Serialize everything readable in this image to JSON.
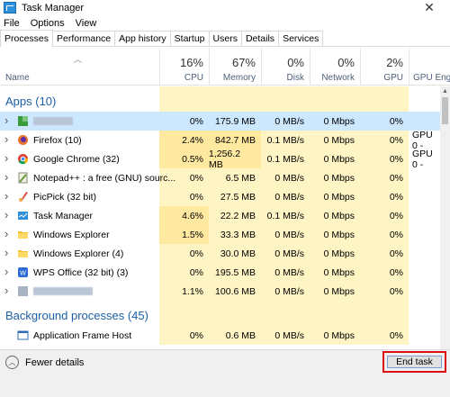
{
  "window": {
    "title": "Task Manager"
  },
  "menu": [
    "File",
    "Options",
    "View"
  ],
  "tabs": [
    "Processes",
    "Performance",
    "App history",
    "Startup",
    "Users",
    "Details",
    "Services"
  ],
  "columns": {
    "name_label": "Name",
    "cpu": {
      "pct": "16%",
      "label": "CPU"
    },
    "memory": {
      "pct": "67%",
      "label": "Memory"
    },
    "disk": {
      "pct": "0%",
      "label": "Disk"
    },
    "network": {
      "pct": "0%",
      "label": "Network"
    },
    "gpu": {
      "pct": "2%",
      "label": "GPU"
    },
    "gpu_engine": {
      "label": "GPU Engin"
    }
  },
  "groups": {
    "apps": "Apps (10)",
    "background": "Background processes (45)"
  },
  "apps": [
    {
      "name": "",
      "icon": "green-app-icon",
      "cpu": "0%",
      "memory": "175.9 MB",
      "disk": "0 MB/s",
      "network": "0 Mbps",
      "gpu": "0%",
      "gpu_engine": ""
    },
    {
      "name": "Firefox (10)",
      "icon": "firefox-icon",
      "cpu": "2.4%",
      "memory": "842.7 MB",
      "disk": "0.1 MB/s",
      "network": "0 Mbps",
      "gpu": "0%",
      "gpu_engine": "GPU 0 -"
    },
    {
      "name": "Google Chrome (32)",
      "icon": "chrome-icon",
      "cpu": "0.5%",
      "memory": "1,256.2 MB",
      "disk": "0.1 MB/s",
      "network": "0 Mbps",
      "gpu": "0%",
      "gpu_engine": "GPU 0 -"
    },
    {
      "name": "Notepad++ : a free (GNU) sourc...",
      "icon": "notepad-icon",
      "cpu": "0%",
      "memory": "6.5 MB",
      "disk": "0 MB/s",
      "network": "0 Mbps",
      "gpu": "0%",
      "gpu_engine": ""
    },
    {
      "name": "PicPick (32 bit)",
      "icon": "picpick-icon",
      "cpu": "0%",
      "memory": "27.5 MB",
      "disk": "0 MB/s",
      "network": "0 Mbps",
      "gpu": "0%",
      "gpu_engine": ""
    },
    {
      "name": "Task Manager",
      "icon": "task-manager-icon",
      "cpu": "4.6%",
      "memory": "22.2 MB",
      "disk": "0.1 MB/s",
      "network": "0 Mbps",
      "gpu": "0%",
      "gpu_engine": ""
    },
    {
      "name": "Windows Explorer",
      "icon": "folder-icon",
      "cpu": "1.5%",
      "memory": "33.3 MB",
      "disk": "0 MB/s",
      "network": "0 Mbps",
      "gpu": "0%",
      "gpu_engine": ""
    },
    {
      "name": "Windows Explorer (4)",
      "icon": "folder-icon",
      "cpu": "0%",
      "memory": "30.0 MB",
      "disk": "0 MB/s",
      "network": "0 Mbps",
      "gpu": "0%",
      "gpu_engine": ""
    },
    {
      "name": "WPS Office (32 bit) (3)",
      "icon": "wps-icon",
      "cpu": "0%",
      "memory": "195.5 MB",
      "disk": "0 MB/s",
      "network": "0 Mbps",
      "gpu": "0%",
      "gpu_engine": ""
    },
    {
      "name": "",
      "icon": "blurred-app-icon",
      "cpu": "1.1%",
      "memory": "100.6 MB",
      "disk": "0 MB/s",
      "network": "0 Mbps",
      "gpu": "0%",
      "gpu_engine": ""
    }
  ],
  "background": [
    {
      "name": "Application Frame Host",
      "icon": "app-frame-icon",
      "cpu": "0%",
      "memory": "0.6 MB",
      "disk": "0 MB/s",
      "network": "0 Mbps",
      "gpu": "0%",
      "gpu_engine": ""
    }
  ],
  "footer": {
    "fewer_details": "Fewer details",
    "end_task": "End task"
  }
}
